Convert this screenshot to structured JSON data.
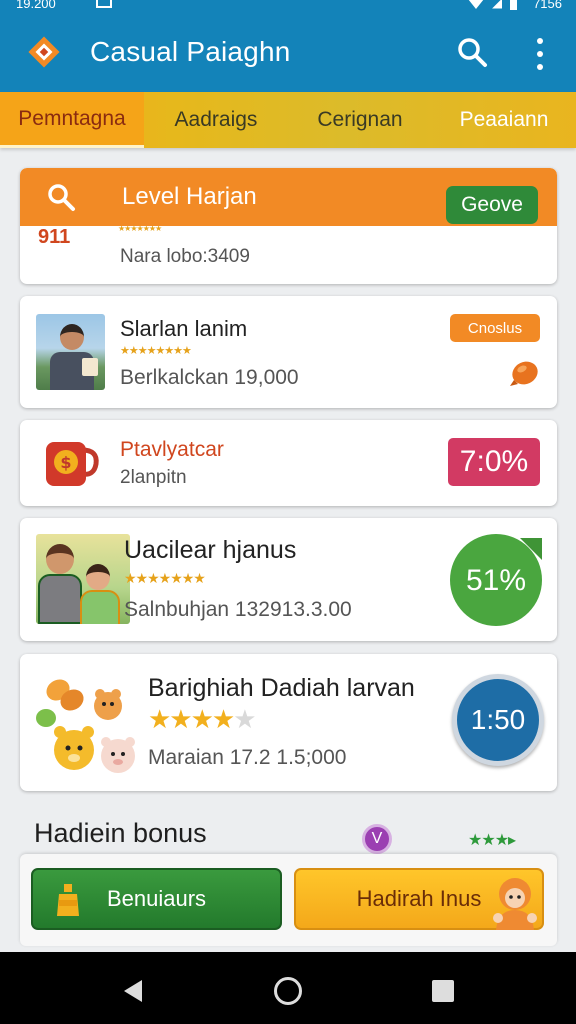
{
  "status_bar": {
    "time": "19.200",
    "right_text": "7156"
  },
  "app": {
    "title": "Casual Paiaghn"
  },
  "tabs": [
    {
      "label": "Pemntagna",
      "active": true
    },
    {
      "label": "Aadraigs",
      "active": false
    },
    {
      "label": "Cerignan",
      "active": false
    },
    {
      "label": "Peaaiann",
      "active": false
    }
  ],
  "cards": {
    "level": {
      "title": "Level Harjan",
      "button": "Geove",
      "icon_text": "911",
      "stars": "★★★★★★★",
      "subtitle": "Nara lobo:3409"
    },
    "player": {
      "name": "Slarlan lanim",
      "stars": "★★★★★★★★",
      "subtitle": "Berlkalckan 19,000",
      "badge": "Cnoslus"
    },
    "reward": {
      "name": "Ptavlyatcar",
      "subtitle": "2lanpitn",
      "percent": "7:0%"
    },
    "family": {
      "name": "Uacilear hjanus",
      "stars": "★★★★★★★",
      "subtitle": "Salnbuhjan  132913.3.00",
      "progress": "51%",
      "progress_value": 0.51
    },
    "bargain": {
      "name": "Barighiah Dadiah larvan",
      "stars_on": "★★★★",
      "stars_off": "★",
      "rating": 4,
      "subtitle": "Maraian  17.2 1.5;000",
      "timer": "1:50"
    }
  },
  "bonus": {
    "title": "Hadiein bonus",
    "v_icon_letter": "V",
    "green_stars": "★★★▸"
  },
  "bottom_buttons": {
    "left": "Benuiaurs",
    "right": "Hadirah Inus"
  },
  "colors": {
    "app_bar": "#1383b9",
    "tab_bar": "#e6b81c",
    "orange": "#f28a25",
    "green": "#2f8a39",
    "pink": "#d23a63",
    "progress_green": "#4aa63f",
    "timer_blue": "#1e6da6"
  },
  "icons": [
    "app-logo-icon",
    "search-icon",
    "more-vert-icon",
    "level-icon",
    "candy-icon",
    "coin-mug-icon",
    "bottle-icon",
    "character-icon",
    "back-icon",
    "home-icon",
    "recents-icon"
  ]
}
